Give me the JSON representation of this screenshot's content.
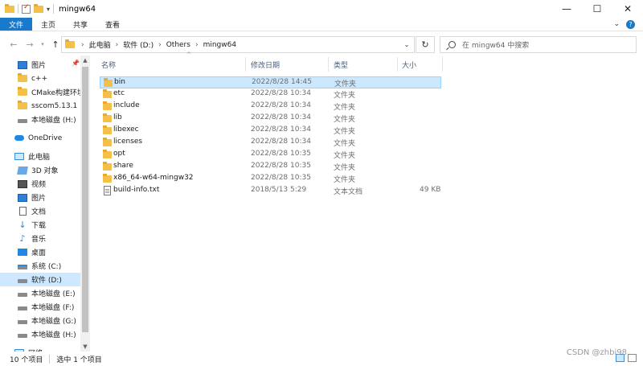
{
  "window": {
    "title": "mingw64",
    "controls": [
      "—",
      "☐",
      "✕"
    ]
  },
  "ribbon": {
    "tabs": [
      "文件",
      "主页",
      "共享",
      "查看"
    ]
  },
  "address": {
    "crumbs": [
      "此电脑",
      "软件 (D:)",
      "Others",
      "mingw64"
    ],
    "search_placeholder": "在 mingw64 中搜索"
  },
  "sidebar": {
    "items": [
      {
        "label": "图片",
        "icon": "picture-icon"
      },
      {
        "label": "c++",
        "icon": "folder-icon"
      },
      {
        "label": "CMake构建环境",
        "icon": "folder-icon"
      },
      {
        "label": "sscom5.13.1",
        "icon": "folder-icon"
      },
      {
        "label": "本地磁盘 (H:)",
        "icon": "drive-icon"
      },
      {
        "label": "OneDrive",
        "icon": "cloud-icon"
      },
      {
        "label": "此电脑",
        "icon": "computer-icon"
      },
      {
        "label": "3D 对象",
        "icon": "3d-objects-icon"
      },
      {
        "label": "视频",
        "icon": "video-icon"
      },
      {
        "label": "图片",
        "icon": "picture-icon"
      },
      {
        "label": "文档",
        "icon": "document-icon"
      },
      {
        "label": "下载",
        "icon": "download-icon"
      },
      {
        "label": "音乐",
        "icon": "music-icon"
      },
      {
        "label": "桌面",
        "icon": "desktop-icon"
      },
      {
        "label": "系统 (C:)",
        "icon": "system-drive-icon"
      },
      {
        "label": "软件 (D:)",
        "icon": "drive-icon",
        "selected": true
      },
      {
        "label": "本地磁盘 (E:)",
        "icon": "drive-icon"
      },
      {
        "label": "本地磁盘 (F:)",
        "icon": "drive-icon"
      },
      {
        "label": "本地磁盘 (G:)",
        "icon": "drive-icon"
      },
      {
        "label": "本地磁盘 (H:)",
        "icon": "drive-icon"
      },
      {
        "label": "网络",
        "icon": "network-icon"
      }
    ]
  },
  "columns": {
    "name": "名称",
    "modified": "修改日期",
    "type": "类型",
    "size": "大小"
  },
  "files": [
    {
      "name": "bin",
      "modified": "2022/8/28 14:45",
      "type": "文件夹",
      "size": "",
      "icon": "folder-icon",
      "selected": true
    },
    {
      "name": "etc",
      "modified": "2022/8/28 10:34",
      "type": "文件夹",
      "size": "",
      "icon": "folder-icon"
    },
    {
      "name": "include",
      "modified": "2022/8/28 10:34",
      "type": "文件夹",
      "size": "",
      "icon": "folder-icon"
    },
    {
      "name": "lib",
      "modified": "2022/8/28 10:34",
      "type": "文件夹",
      "size": "",
      "icon": "folder-icon"
    },
    {
      "name": "libexec",
      "modified": "2022/8/28 10:34",
      "type": "文件夹",
      "size": "",
      "icon": "folder-icon"
    },
    {
      "name": "licenses",
      "modified": "2022/8/28 10:34",
      "type": "文件夹",
      "size": "",
      "icon": "folder-icon"
    },
    {
      "name": "opt",
      "modified": "2022/8/28 10:35",
      "type": "文件夹",
      "size": "",
      "icon": "folder-icon"
    },
    {
      "name": "share",
      "modified": "2022/8/28 10:35",
      "type": "文件夹",
      "size": "",
      "icon": "folder-icon"
    },
    {
      "name": "x86_64-w64-mingw32",
      "modified": "2022/8/28 10:35",
      "type": "文件夹",
      "size": "",
      "icon": "folder-icon"
    },
    {
      "name": "build-info.txt",
      "modified": "2018/5/13 5:29",
      "type": "文本文档",
      "size": "49 KB",
      "icon": "text-file-icon"
    }
  ],
  "status": {
    "count": "10 个项目",
    "selection": "选中 1 个项目"
  },
  "watermark": "CSDN @zhbi98",
  "colors": {
    "accent": "#1979ca",
    "selection": "#cce8ff",
    "folder": "#f3c14a"
  }
}
